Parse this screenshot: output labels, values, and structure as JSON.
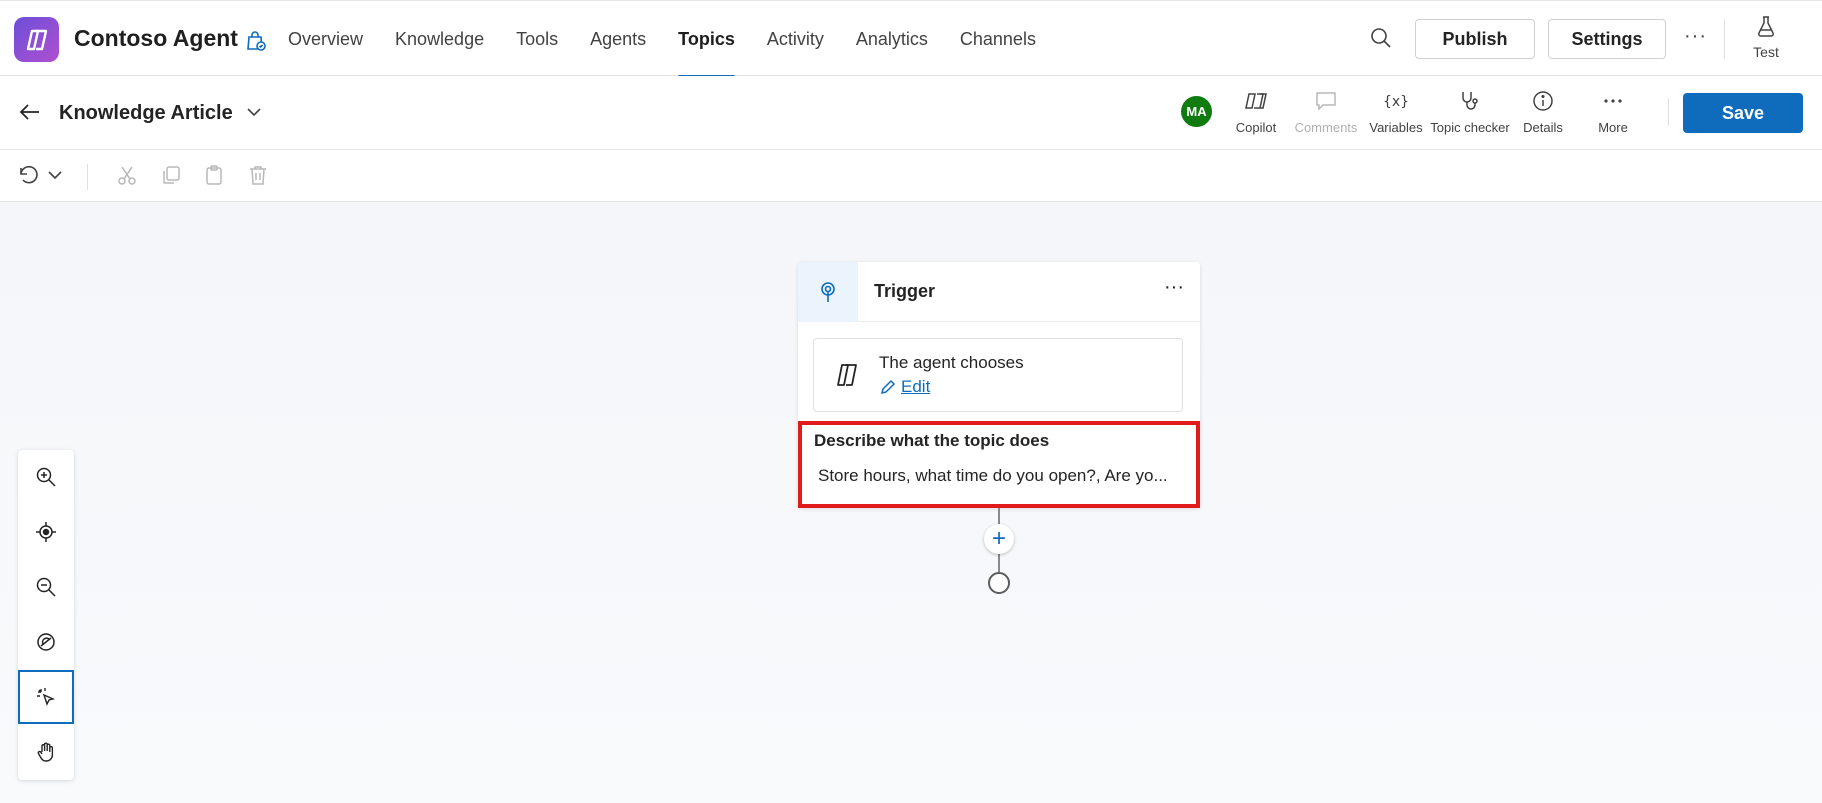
{
  "app": {
    "name": "Contoso Agent",
    "logo_icon": "copilot-studio-logo-icon",
    "accent_color": "#0f6cbd"
  },
  "nav": {
    "tabs": [
      {
        "label": "Overview",
        "active": false
      },
      {
        "label": "Knowledge",
        "active": false
      },
      {
        "label": "Tools",
        "active": false
      },
      {
        "label": "Agents",
        "active": false
      },
      {
        "label": "Topics",
        "active": true
      },
      {
        "label": "Activity",
        "active": false
      },
      {
        "label": "Analytics",
        "active": false
      },
      {
        "label": "Channels",
        "active": false
      }
    ],
    "publish_label": "Publish",
    "settings_label": "Settings",
    "more_label": "···",
    "test_label": "Test"
  },
  "topic": {
    "title": "Knowledge Article",
    "avatar_initials": "MA",
    "avatar_color": "#107c10",
    "tools": [
      {
        "label": "Copilot",
        "icon": "copilot-icon",
        "disabled": false
      },
      {
        "label": "Comments",
        "icon": "comment-icon",
        "disabled": true
      },
      {
        "label": "Variables",
        "icon": "variables-icon",
        "disabled": false
      },
      {
        "label": "Topic checker",
        "icon": "stethoscope-icon",
        "disabled": false
      },
      {
        "label": "Details",
        "icon": "info-icon",
        "disabled": false
      },
      {
        "label": "More",
        "icon": "more-icon",
        "disabled": false
      }
    ],
    "save_label": "Save"
  },
  "canvas": {
    "trigger": {
      "label": "Trigger",
      "more_label": "···",
      "agent_chooses": "The agent chooses",
      "edit_label": "Edit",
      "describe_label": "Describe what the topic does",
      "describe_value": "Store hours, what time do you open?, Are yo...",
      "highlight_color": "#e01b1b"
    },
    "add_node_label": "+"
  }
}
